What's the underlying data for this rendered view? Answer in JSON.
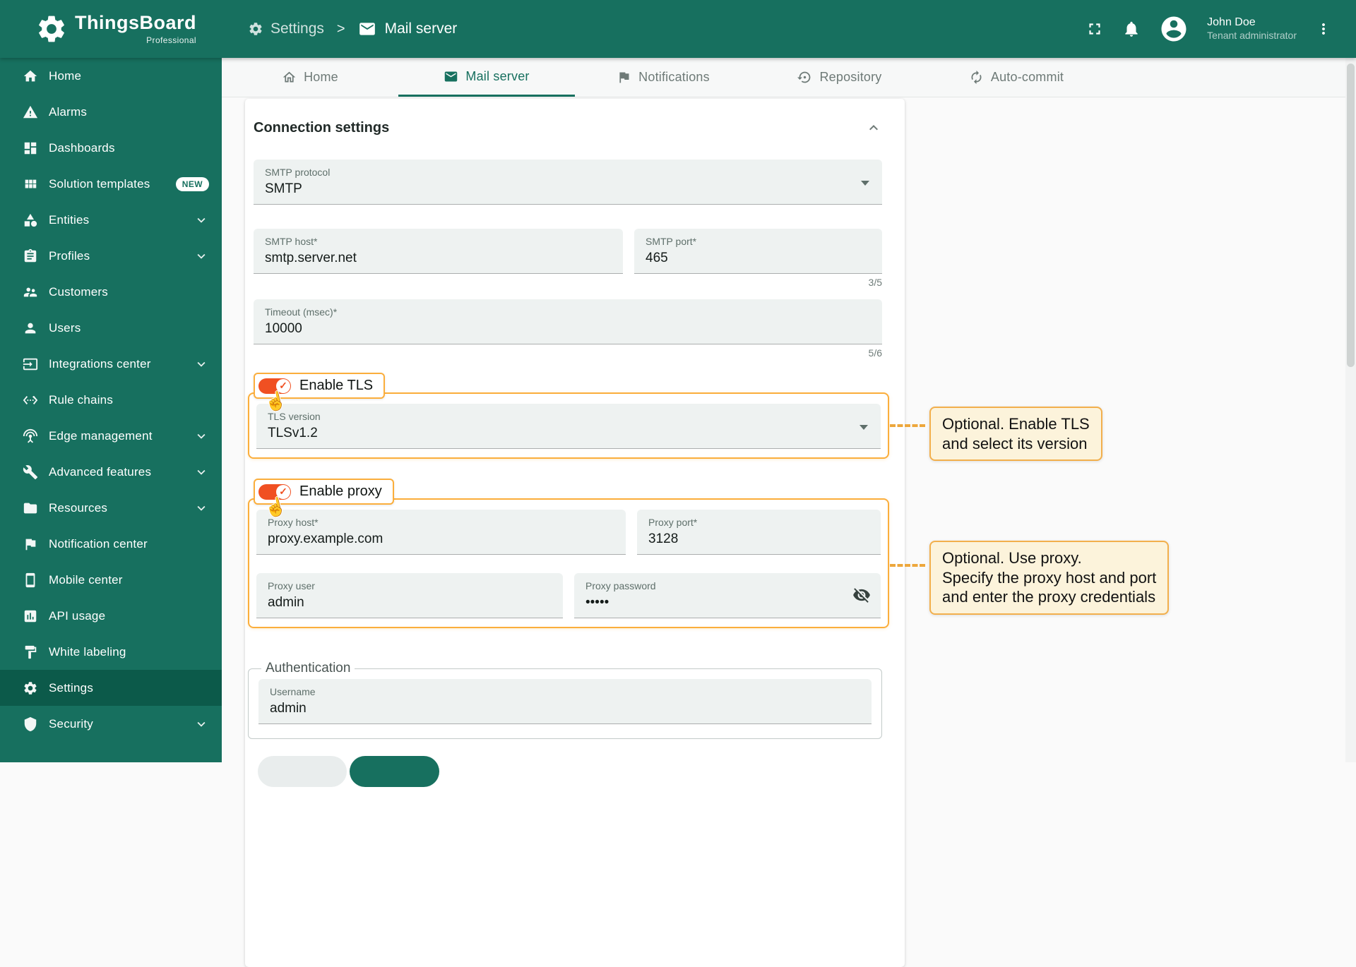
{
  "header": {
    "app_name": "ThingsBoard",
    "app_edition": "Professional",
    "breadcrumb": {
      "section": "Settings",
      "separator": ">",
      "page": "Mail server"
    },
    "user": {
      "name": "John Doe",
      "role": "Tenant administrator"
    }
  },
  "sidebar": {
    "items": [
      {
        "label": "Home",
        "icon": "home-icon"
      },
      {
        "label": "Alarms",
        "icon": "alarms-icon"
      },
      {
        "label": "Dashboards",
        "icon": "dashboards-icon"
      },
      {
        "label": "Solution templates",
        "icon": "solution-templates-icon",
        "badge": "NEW"
      },
      {
        "label": "Entities",
        "icon": "entities-icon",
        "expandable": true
      },
      {
        "label": "Profiles",
        "icon": "profiles-icon",
        "expandable": true
      },
      {
        "label": "Customers",
        "icon": "customers-icon"
      },
      {
        "label": "Users",
        "icon": "users-icon"
      },
      {
        "label": "Integrations center",
        "icon": "integrations-center-icon",
        "expandable": true
      },
      {
        "label": "Rule chains",
        "icon": "rule-chains-icon"
      },
      {
        "label": "Edge management",
        "icon": "edge-management-icon",
        "expandable": true
      },
      {
        "label": "Advanced features",
        "icon": "advanced-features-icon",
        "expandable": true
      },
      {
        "label": "Resources",
        "icon": "resources-icon",
        "expandable": true
      },
      {
        "label": "Notification center",
        "icon": "notification-center-icon"
      },
      {
        "label": "Mobile center",
        "icon": "mobile-center-icon"
      },
      {
        "label": "API usage",
        "icon": "api-usage-icon"
      },
      {
        "label": "White labeling",
        "icon": "white-labeling-icon"
      },
      {
        "label": "Settings",
        "icon": "settings-icon",
        "active": true
      },
      {
        "label": "Security",
        "icon": "security-icon",
        "expandable": true
      }
    ]
  },
  "tabs": [
    {
      "label": "Home"
    },
    {
      "label": "Mail server",
      "active": true
    },
    {
      "label": "Notifications"
    },
    {
      "label": "Repository"
    },
    {
      "label": "Auto-commit"
    }
  ],
  "connection": {
    "title": "Connection settings",
    "smtp_protocol": {
      "label": "SMTP protocol",
      "value": "SMTP"
    },
    "smtp_host": {
      "label": "SMTP host*",
      "value": "smtp.server.net"
    },
    "smtp_port": {
      "label": "SMTP port*",
      "value": "465",
      "hint": "3/5"
    },
    "timeout": {
      "label": "Timeout (msec)*",
      "value": "10000",
      "hint": "5/6"
    },
    "enable_tls": "Enable TLS",
    "tls_version": {
      "label": "TLS version",
      "value": "TLSv1.2"
    },
    "enable_proxy": "Enable proxy",
    "proxy_host": {
      "label": "Proxy host*",
      "value": "proxy.example.com"
    },
    "proxy_port": {
      "label": "Proxy port*",
      "value": "3128"
    },
    "proxy_user": {
      "label": "Proxy user",
      "value": "admin"
    },
    "proxy_password": {
      "label": "Proxy password",
      "value": "•••••"
    }
  },
  "authentication": {
    "legend": "Authentication",
    "username": {
      "label": "Username",
      "value": "admin"
    }
  },
  "callouts": [
    {
      "lines": [
        "Optional. Enable TLS",
        "and select its version"
      ]
    },
    {
      "lines": [
        "Optional. Use proxy.",
        "Specify the proxy host and port",
        "and enter the proxy credentials"
      ]
    }
  ],
  "colors": {
    "primary": "#17705F",
    "primary-dark": "#0C5A4A",
    "highlight": "#FBAE3C",
    "toggle": "#F05022",
    "callout-bg": "#FCF3DB",
    "callout-border": "#F2AF4C"
  }
}
